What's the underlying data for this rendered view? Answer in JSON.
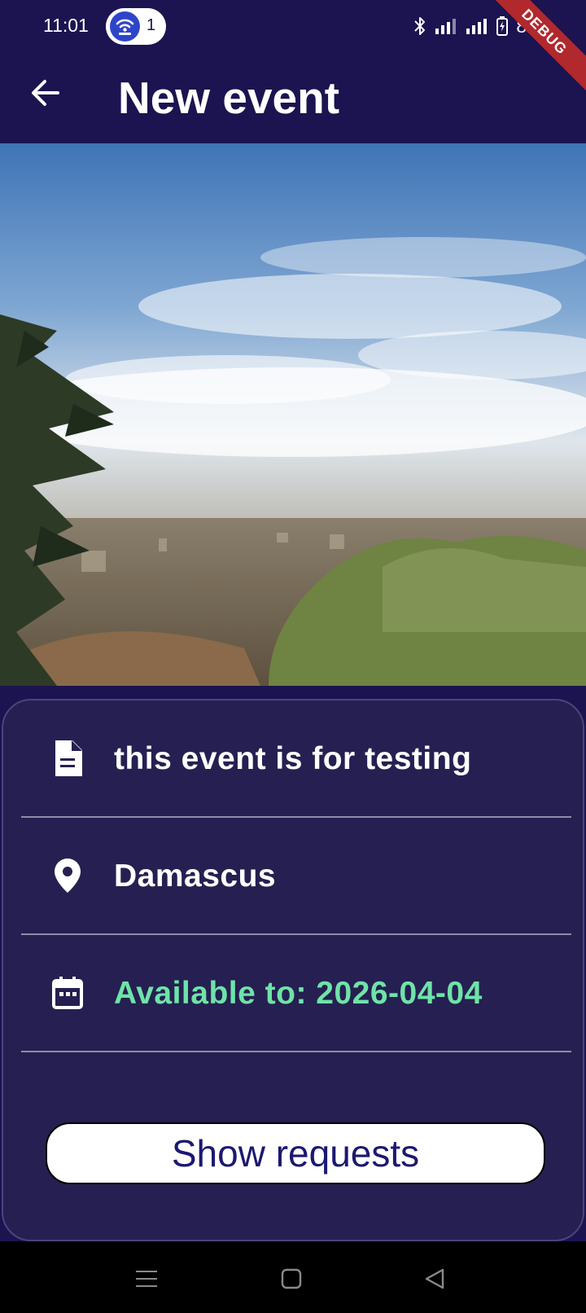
{
  "status_bar": {
    "time": "11:01",
    "wifi_badge_count": "1",
    "battery_text": "88",
    "icons": [
      "wifi-hotspot-icon",
      "bluetooth-icon",
      "signal-icon",
      "signal-icon",
      "battery-icon"
    ]
  },
  "debug_banner": "DEBUG",
  "app_bar": {
    "back_icon": "arrow-back-icon",
    "title": "New event"
  },
  "event": {
    "description": "this event is for testing",
    "location": "Damascus",
    "available_to": "Available to: 2026-04-04",
    "description_icon": "document-icon",
    "location_icon": "location-pin-icon",
    "date_icon": "calendar-icon"
  },
  "actions": {
    "show_requests_label": "Show requests"
  },
  "nav_bar": {
    "icons": [
      "menu-icon",
      "home-square-icon",
      "back-triangle-icon"
    ]
  },
  "colors": {
    "background": "#1b1450",
    "card": "#252051",
    "accent_green": "#6fe3a8",
    "button_text": "#1b1970",
    "debug_red": "#b1282d"
  }
}
